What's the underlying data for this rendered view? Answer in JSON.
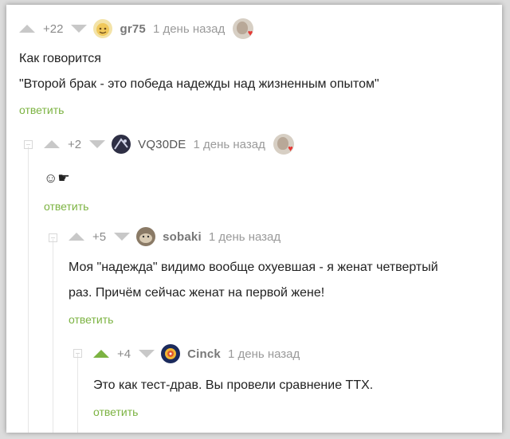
{
  "comments": [
    {
      "score": "+22",
      "nick": "gr75",
      "time": "1 день назад",
      "lines": [
        "Как говорится",
        "\"Второй брак - это победа надежды над жизненным опытом\""
      ],
      "reply": "ответить",
      "up_active": false
    },
    {
      "score": "+2",
      "nick": "VQ30DE",
      "time": "1 день назад",
      "emoji": "☺☛",
      "reply": "ответить",
      "up_active": false
    },
    {
      "score": "+5",
      "nick": "sobaki",
      "time": "1 день назад",
      "lines": [
        "Моя \"надежда\" видимо вообще охуевшая - я женат четвертый",
        "раз. Причём сейчас женат на первой жене!"
      ],
      "reply": "ответить",
      "up_active": false
    },
    {
      "score": "+4",
      "nick": "Cinck",
      "time": "1 день назад",
      "lines": [
        "Это как тест-драв. Вы провели сравнение ТТХ."
      ],
      "reply": "ответить",
      "up_active": true
    }
  ],
  "colors": {
    "accent": "#7cb342",
    "vote_inactive": "#c8c8c8",
    "badge_heart": "#e53935"
  }
}
